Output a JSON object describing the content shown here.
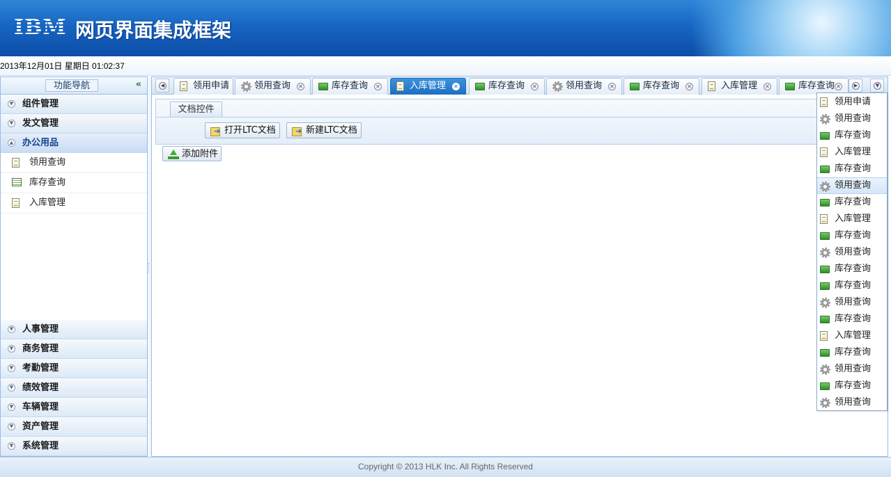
{
  "header": {
    "logo": "IBM",
    "title": "网页界面集成框架"
  },
  "datebar": {
    "datetime": "2013年12月01日 星期日 01:02:37"
  },
  "sidebar": {
    "title": "功能导航",
    "collapse_icon": "double-chevron-left-icon",
    "top_groups": [
      {
        "label": "组件管理",
        "state": "collapsed"
      },
      {
        "label": "发文管理",
        "state": "collapsed"
      },
      {
        "label": "办公用品",
        "state": "expanded"
      }
    ],
    "items": [
      {
        "label": "领用查询",
        "icon": "page-icon"
      },
      {
        "label": "库存查询",
        "icon": "table-icon"
      },
      {
        "label": "入库管理",
        "icon": "page-icon"
      }
    ],
    "bottom_groups": [
      {
        "label": "人事管理"
      },
      {
        "label": "商务管理"
      },
      {
        "label": "考勤管理"
      },
      {
        "label": "绩效管理"
      },
      {
        "label": "车辆管理"
      },
      {
        "label": "资产管理"
      },
      {
        "label": "系统管理"
      }
    ]
  },
  "tabs": [
    {
      "label": "领用申请",
      "icon": "page-icon",
      "closable": false,
      "active": false
    },
    {
      "label": "领用查询",
      "icon": "gear-icon",
      "closable": true,
      "active": false
    },
    {
      "label": "库存查询",
      "icon": "folder-icon",
      "closable": true,
      "active": false
    },
    {
      "label": "入库管理",
      "icon": "page-icon",
      "closable": true,
      "active": true
    },
    {
      "label": "库存查询",
      "icon": "folder-icon",
      "closable": true,
      "active": false
    },
    {
      "label": "领用查询",
      "icon": "gear-icon",
      "closable": true,
      "active": false
    },
    {
      "label": "库存查询",
      "icon": "folder-icon",
      "closable": true,
      "active": false
    },
    {
      "label": "入库管理",
      "icon": "page-icon",
      "closable": true,
      "active": false
    },
    {
      "label": "库存查询",
      "icon": "folder-icon",
      "closable": true,
      "active": false
    }
  ],
  "panel": {
    "tab_label": "文档控件",
    "open_button": "打开LTC文档",
    "new_button": "新建LTC文档",
    "attach_button": "添加附件"
  },
  "dropdown": {
    "highlighted_index": 5,
    "items": [
      {
        "label": "领用申请",
        "icon": "page-icon"
      },
      {
        "label": "领用查询",
        "icon": "gear-icon"
      },
      {
        "label": "库存查询",
        "icon": "folder-icon"
      },
      {
        "label": "入库管理",
        "icon": "page-icon"
      },
      {
        "label": "库存查询",
        "icon": "folder-icon"
      },
      {
        "label": "领用查询",
        "icon": "gear-icon"
      },
      {
        "label": "库存查询",
        "icon": "folder-icon"
      },
      {
        "label": "入库管理",
        "icon": "page-icon"
      },
      {
        "label": "库存查询",
        "icon": "folder-icon"
      },
      {
        "label": "领用查询",
        "icon": "gear-icon"
      },
      {
        "label": "库存查询",
        "icon": "folder-icon"
      },
      {
        "label": "库存查询",
        "icon": "folder-icon"
      },
      {
        "label": "领用查询",
        "icon": "gear-icon"
      },
      {
        "label": "库存查询",
        "icon": "folder-icon"
      },
      {
        "label": "入库管理",
        "icon": "page-icon"
      },
      {
        "label": "库存查询",
        "icon": "folder-icon"
      },
      {
        "label": "领用查询",
        "icon": "gear-icon"
      },
      {
        "label": "库存查询",
        "icon": "folder-icon"
      },
      {
        "label": "领用查询",
        "icon": "gear-icon"
      }
    ]
  },
  "footer": {
    "copyright": "Copyright © 2013 HLK Inc. All Rights Reserved"
  },
  "colors": {
    "header_blue": "#1765c2",
    "active_tab": "#1d6fc2",
    "border": "#99bbe8"
  }
}
